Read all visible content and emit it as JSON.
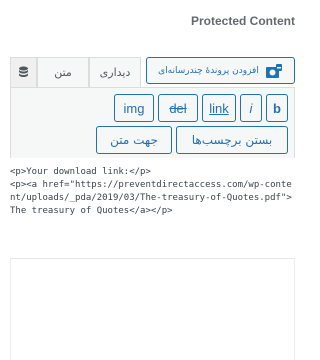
{
  "header": {
    "title": "Protected Content"
  },
  "tabs": {
    "visual_label": "دیداری",
    "text_label": "متن"
  },
  "media_button": {
    "label": "افزودن پروندهٔ چندرسانه‌ای"
  },
  "toolbar": {
    "bold": "b",
    "italic": "i",
    "link": "link",
    "delete": "del",
    "image": "img",
    "close_tags": "بستن برچسب‌ها",
    "text_direction": "جهت متن"
  },
  "editor": {
    "content": "<p>Your download link:</p>\n<p><a href=\"https://preventdirectaccess.com/wp-content/uploads/_pda/2019/03/The-treasury-of-Quotes.pdf\">The treasury of Quotes</a></p>"
  },
  "icons": {
    "database": "database-icon",
    "media": "media-icon"
  }
}
